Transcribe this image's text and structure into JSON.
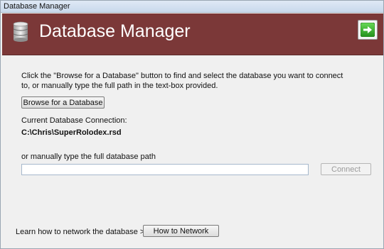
{
  "window": {
    "title": "Database Manager"
  },
  "header": {
    "title": "Database Manager",
    "bg_color": "#7b3838",
    "icon": "database-icon",
    "next_icon": "green-arrow-right-icon"
  },
  "instructions": {
    "line1": "Click the \"Browse for a Database\" button to find and select the database you want to connect",
    "line2": "to, or manually type the full path in the text-box provided."
  },
  "browse_button_label": "Browse for a Database",
  "current_connection": {
    "label": "Current Database Connection:",
    "value": "C:\\Chris\\SuperRolodex.rsd"
  },
  "manual": {
    "label": "or manually type the full database path",
    "input_value": "",
    "connect_label": "Connect"
  },
  "network": {
    "text": "Learn how to network the database >>",
    "button_label": "How to Network"
  }
}
